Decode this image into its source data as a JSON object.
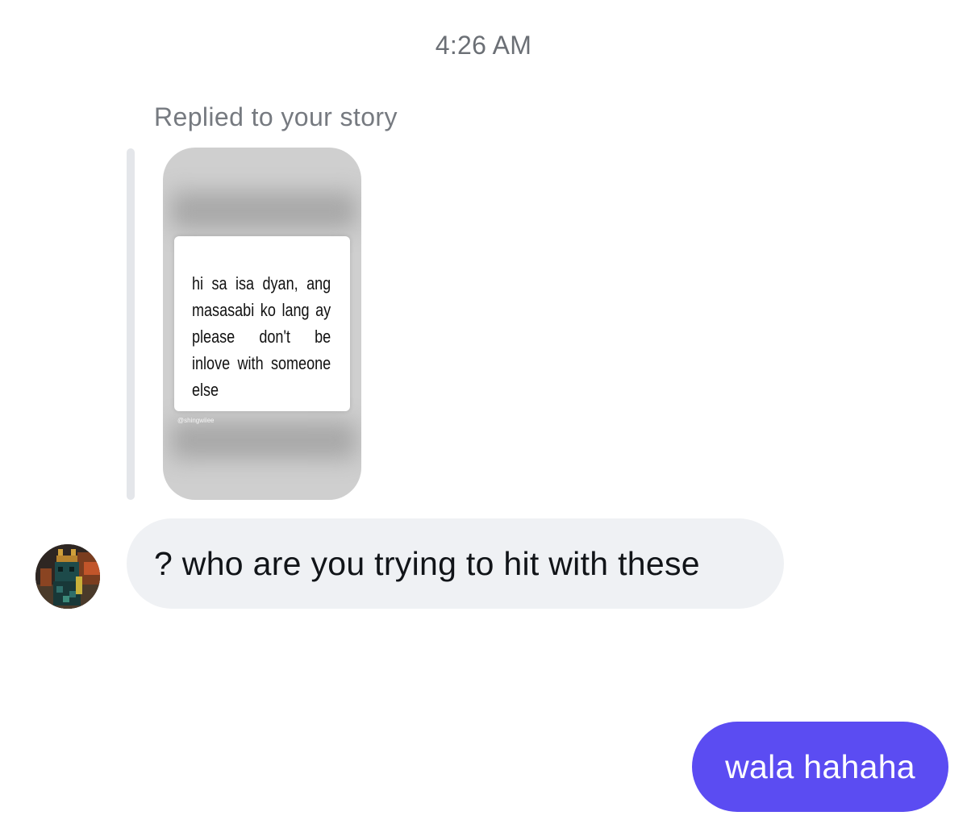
{
  "header": {
    "timestamp": "4:26 AM"
  },
  "story_reply": {
    "label": "Replied to your story",
    "story_text": "hi sa isa dyan, ang masasabi ko lang ay please don't be inlove with someone else",
    "story_handle": "@shingwiiee"
  },
  "messages": {
    "incoming": {
      "text": "? who are you trying to hit with these",
      "avatar_icon": "user-avatar"
    },
    "outgoing": {
      "text": "wala hahaha"
    }
  },
  "colors": {
    "outgoing_bubble": "#5b4cf2",
    "incoming_bubble": "#eff1f4",
    "timestamp_text": "#6b6f75"
  }
}
